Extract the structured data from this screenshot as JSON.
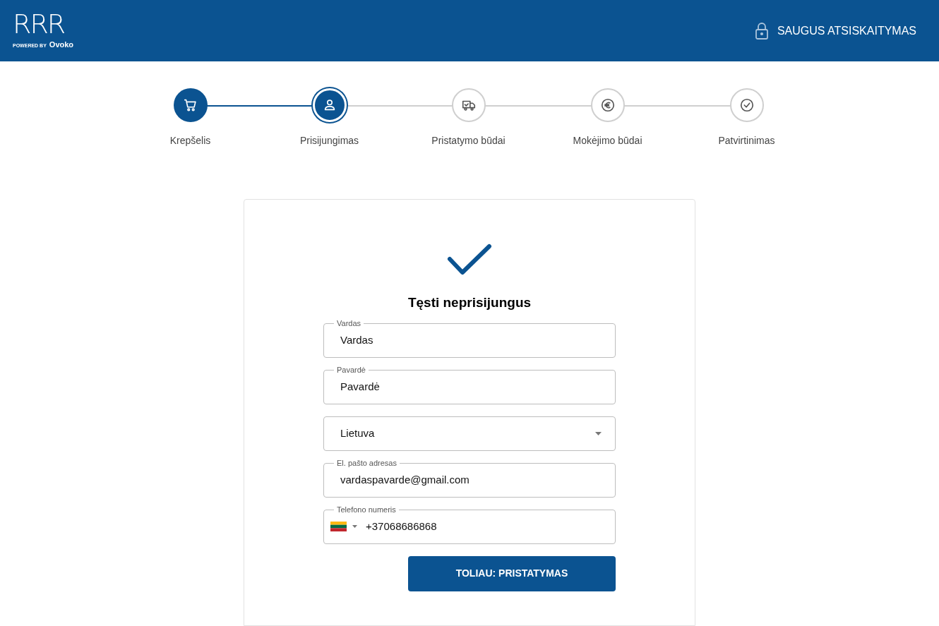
{
  "header": {
    "logo": {
      "letters": "RRR",
      "powered_by": "POWERED BY",
      "brand": "Ovoko"
    },
    "secure_label": "SAUGUS ATSISKAITYMAS"
  },
  "steps": [
    {
      "label": "Krepšelis",
      "kind": "cart",
      "completed": true,
      "selected": false
    },
    {
      "label": "Prisijungimas",
      "kind": "user",
      "completed": false,
      "selected": true
    },
    {
      "label": "Pristatymo būdai",
      "kind": "truck",
      "completed": false,
      "selected": false
    },
    {
      "label": "Mokėjimo būdai",
      "kind": "euro",
      "completed": false,
      "selected": false
    },
    {
      "label": "Patvirtinimas",
      "kind": "check",
      "completed": false,
      "selected": false
    }
  ],
  "form": {
    "title": "Tęsti neprisijungus",
    "fields": [
      {
        "kind": "text",
        "label": "Vardas",
        "value": "Vardas"
      },
      {
        "kind": "text",
        "label": "Pavardė",
        "value": "Pavardė"
      },
      {
        "kind": "select",
        "value": "Lietuva"
      },
      {
        "kind": "text",
        "label": "El. pašto adresas",
        "value": "vardaspavarde@gmail.com"
      },
      {
        "kind": "phone",
        "label": "Telefono numeris",
        "value": "+37068686868"
      }
    ],
    "submit": "TOLIAU: PRISTATYMAS"
  }
}
